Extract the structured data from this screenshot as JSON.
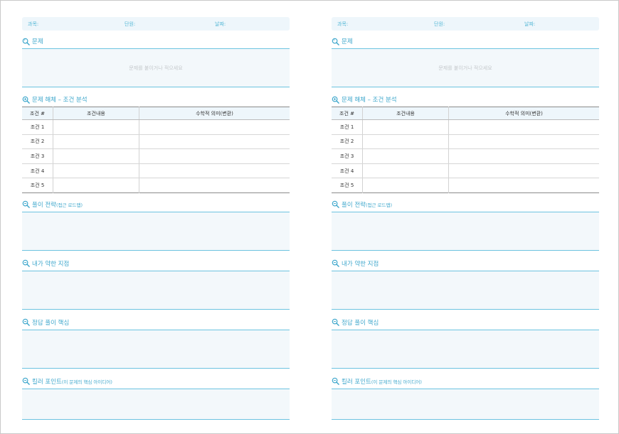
{
  "header": {
    "subject": "과목:",
    "unit": "단원:",
    "date": "날짜:"
  },
  "problem": {
    "title": "문제",
    "placeholder": "문제를 붙이거나 적으세요"
  },
  "analysis": {
    "title": "문제 해체 – 조건 분석",
    "columns": [
      "조건 #",
      "조건내용",
      "수학적 의미(변환)"
    ],
    "rows": [
      "조건 1",
      "조건 2",
      "조건 3",
      "조건 4",
      "조건 5"
    ]
  },
  "strategy": {
    "title": "풀이 전략",
    "subtitle": "(접근 로드맵)"
  },
  "weak": {
    "title": "내가 약한 지점"
  },
  "answer": {
    "title": "정답 풀이 핵심"
  },
  "killer": {
    "title": "킬러 포인트",
    "subtitle": "(이 문제의 핵심 아이디어)"
  },
  "colors": {
    "accent": "#3ea7cc",
    "box_fill": "#f3f8fb",
    "rule": "#6cc3e0"
  },
  "icons": {
    "section": "magnifier-icon",
    "analysis": "magnifier-plus-icon",
    "strategy": "magnifier-minus-icon"
  }
}
